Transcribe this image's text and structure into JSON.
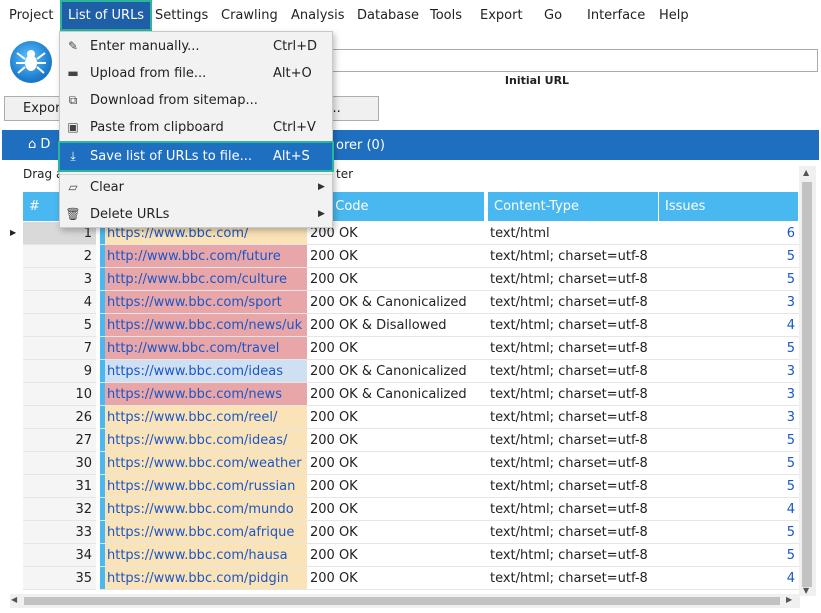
{
  "menubar": {
    "items": [
      "Project",
      "List of URLs",
      "Settings",
      "Crawling",
      "Analysis",
      "Database",
      "Tools",
      "Export",
      "Go",
      "Interface",
      "Help"
    ],
    "active_index": 1
  },
  "toolbar": {
    "url_label": "Initial URL",
    "export_label": "Export",
    "second_button_label": "nt..."
  },
  "panel": {
    "tab_label_partial": "D",
    "tab2_label_partial": "orer (0)",
    "drag_hint": "Drag a",
    "drag_hint_end": "ter"
  },
  "dropdown": {
    "items": [
      {
        "icon": "edit-icon",
        "label": "Enter manually...",
        "shortcut": "Ctrl+D"
      },
      {
        "icon": "folder-open-icon",
        "label": "Upload from file...",
        "shortcut": "Alt+O"
      },
      {
        "icon": "sitemap-icon",
        "label": "Download from sitemap...",
        "shortcut": ""
      },
      {
        "icon": "clipboard-icon",
        "label": "Paste from clipboard",
        "shortcut": "Ctrl+V"
      },
      {
        "icon": "download-icon",
        "label": "Save list of URLs to file...",
        "shortcut": "Alt+S"
      },
      {
        "icon": "eraser-icon",
        "label": "Clear",
        "shortcut": ""
      },
      {
        "icon": "trash-icon",
        "label": "Delete URLs",
        "shortcut": ""
      }
    ],
    "highlighted_index": 4
  },
  "grid": {
    "columns": [
      "#",
      "tus Code",
      "Content-Type",
      "Issues"
    ],
    "rows": [
      {
        "num": "1",
        "url": "https://www.bbc.com/",
        "status": "200 OK",
        "ctype": "text/html",
        "issues": "6",
        "bg": "#fbe3b8"
      },
      {
        "num": "2",
        "url": "http://www.bbc.com/future",
        "status": "200 OK",
        "ctype": "text/html; charset=utf-8",
        "issues": "5",
        "bg": "#e8a6a8"
      },
      {
        "num": "3",
        "url": "http://www.bbc.com/culture",
        "status": "200 OK",
        "ctype": "text/html; charset=utf-8",
        "issues": "5",
        "bg": "#e8a6a8"
      },
      {
        "num": "4",
        "url": "https://www.bbc.com/sport",
        "status": "200 OK & Canonicalized",
        "ctype": "text/html; charset=utf-8",
        "issues": "3",
        "bg": "#e8a6a8"
      },
      {
        "num": "5",
        "url": "https://www.bbc.com/news/uk",
        "status": "200 OK & Disallowed",
        "ctype": "text/html; charset=utf-8",
        "issues": "4",
        "bg": "#e8a6a8"
      },
      {
        "num": "7",
        "url": "http://www.bbc.com/travel",
        "status": "200 OK",
        "ctype": "text/html; charset=utf-8",
        "issues": "5",
        "bg": "#e8a6a8"
      },
      {
        "num": "9",
        "url": "https://www.bbc.com/ideas",
        "status": "200 OK & Canonicalized",
        "ctype": "text/html; charset=utf-8",
        "issues": "3",
        "bg": "#cfe0f3"
      },
      {
        "num": "10",
        "url": "https://www.bbc.com/news",
        "status": "200 OK & Canonicalized",
        "ctype": "text/html; charset=utf-8",
        "issues": "3",
        "bg": "#e8a6a8"
      },
      {
        "num": "26",
        "url": "https://www.bbc.com/reel/",
        "status": "200 OK",
        "ctype": "text/html; charset=utf-8",
        "issues": "3",
        "bg": "#fbe3b8"
      },
      {
        "num": "27",
        "url": "https://www.bbc.com/ideas/",
        "status": "200 OK",
        "ctype": "text/html; charset=utf-8",
        "issues": "5",
        "bg": "#fbe3b8"
      },
      {
        "num": "30",
        "url": "https://www.bbc.com/weather",
        "status": "200 OK",
        "ctype": "text/html; charset=utf-8",
        "issues": "5",
        "bg": "#fbe3b8"
      },
      {
        "num": "31",
        "url": "https://www.bbc.com/russian",
        "status": "200 OK",
        "ctype": "text/html; charset=utf-8",
        "issues": "5",
        "bg": "#fbe3b8"
      },
      {
        "num": "32",
        "url": "https://www.bbc.com/mundo",
        "status": "200 OK",
        "ctype": "text/html; charset=utf-8",
        "issues": "4",
        "bg": "#fbe3b8"
      },
      {
        "num": "33",
        "url": "https://www.bbc.com/afrique",
        "status": "200 OK",
        "ctype": "text/html; charset=utf-8",
        "issues": "5",
        "bg": "#fbe3b8"
      },
      {
        "num": "34",
        "url": "https://www.bbc.com/hausa",
        "status": "200 OK",
        "ctype": "text/html; charset=utf-8",
        "issues": "5",
        "bg": "#fbe3b8"
      },
      {
        "num": "35",
        "url": "https://www.bbc.com/pidgin",
        "status": "200 OK",
        "ctype": "text/html; charset=utf-8",
        "issues": "4",
        "bg": "#fbe3b8"
      }
    ]
  }
}
